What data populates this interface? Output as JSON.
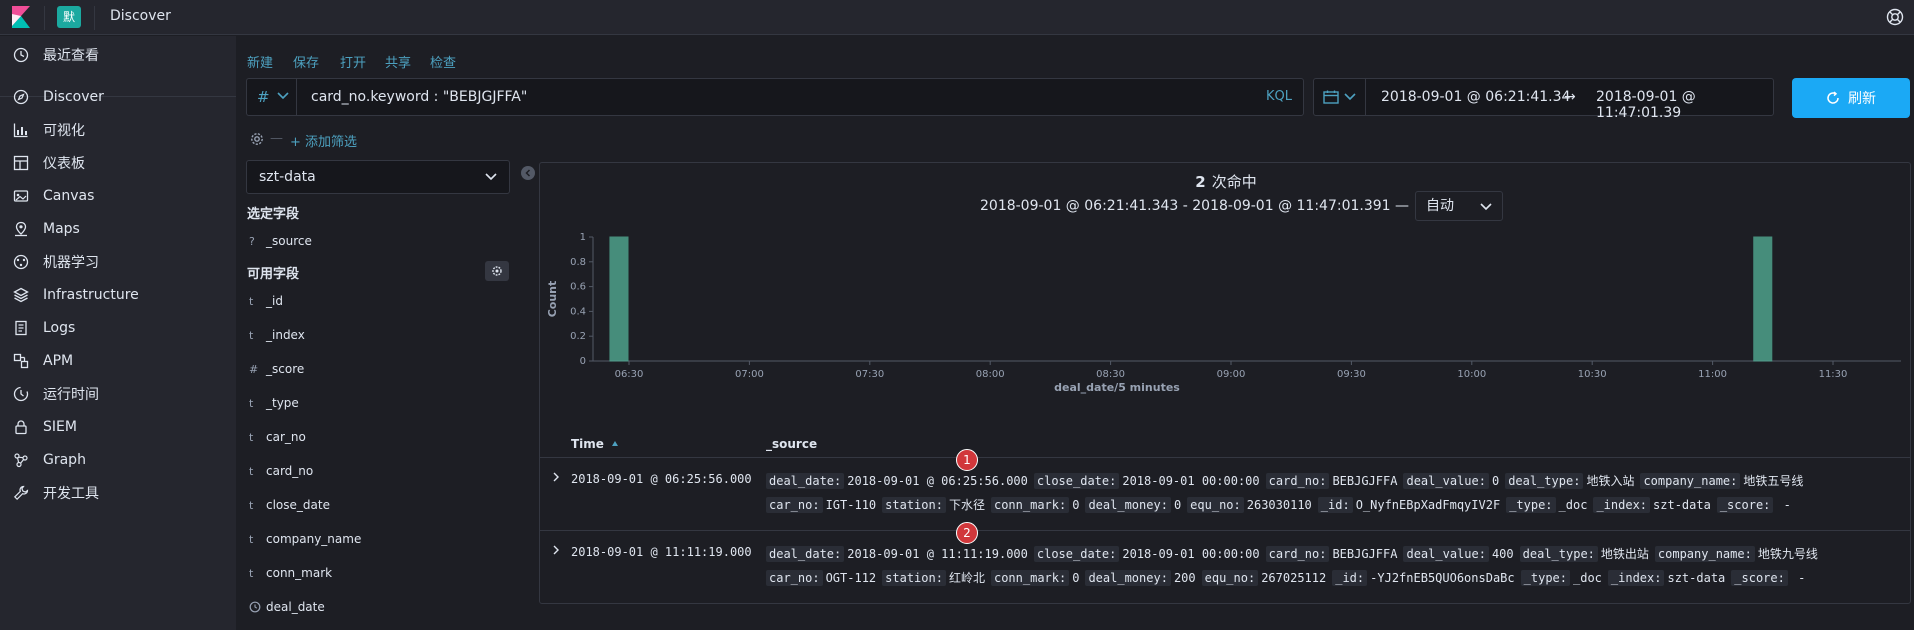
{
  "header": {
    "space_badge": "默",
    "app_title": "Discover"
  },
  "nav": {
    "items": [
      {
        "label": "最近查看",
        "icon": "clock-icon"
      },
      {
        "label": "Discover",
        "icon": "compass-icon"
      },
      {
        "label": "可视化",
        "icon": "visualize-icon"
      },
      {
        "label": "仪表板",
        "icon": "dashboard-icon"
      },
      {
        "label": "Canvas",
        "icon": "canvas-icon"
      },
      {
        "label": "Maps",
        "icon": "maps-icon"
      },
      {
        "label": "机器学习",
        "icon": "ml-icon"
      },
      {
        "label": "Infrastructure",
        "icon": "infrastructure-icon"
      },
      {
        "label": "Logs",
        "icon": "logs-icon"
      },
      {
        "label": "APM",
        "icon": "apm-icon"
      },
      {
        "label": "运行时间",
        "icon": "uptime-icon"
      },
      {
        "label": "SIEM",
        "icon": "siem-icon"
      },
      {
        "label": "Graph",
        "icon": "graph-icon"
      },
      {
        "label": "开发工具",
        "icon": "devtools-icon"
      }
    ]
  },
  "app_links": [
    "新建",
    "保存",
    "打开",
    "共享",
    "检查"
  ],
  "query": {
    "type_symbol": "#",
    "text": "card_no.keyword : \"BEBJGJFFA\"",
    "language": "KQL"
  },
  "date_picker": {
    "start": "2018-09-01 @ 06:21:41.34",
    "arrow": "→",
    "end": "2018-09-01 @ 11:47:01.39"
  },
  "refresh_label": "刷新",
  "filter": {
    "dash": "—",
    "add_label": "+ 添加筛选"
  },
  "sidebar": {
    "index_pattern": "szt-data",
    "selected_title": "选定字段",
    "selected_fields": [
      {
        "type": "?",
        "name": "_source"
      }
    ],
    "available_title": "可用字段",
    "available_fields": [
      {
        "type": "t",
        "name": "_id"
      },
      {
        "type": "t",
        "name": "_index"
      },
      {
        "type": "#",
        "name": "_score"
      },
      {
        "type": "t",
        "name": "_type"
      },
      {
        "type": "t",
        "name": "car_no"
      },
      {
        "type": "t",
        "name": "card_no"
      },
      {
        "type": "t",
        "name": "close_date"
      },
      {
        "type": "t",
        "name": "company_name"
      },
      {
        "type": "t",
        "name": "conn_mark"
      },
      {
        "type": "clock",
        "name": "deal_date"
      }
    ]
  },
  "hits": {
    "count": "2",
    "label": "次命中"
  },
  "range": {
    "text": "2018-09-01 @ 06:21:41.343 - 2018-09-01 @ 11:47:01.391 —",
    "interval": "自动"
  },
  "chart_data": {
    "type": "bar",
    "xlabel": "deal_date/5 minutes",
    "ylabel": "Count",
    "ylim": [
      0,
      1
    ],
    "yticks": [
      "0",
      "0.2",
      "0.4",
      "0.6",
      "0.8",
      "1"
    ],
    "xticks": [
      "06:30",
      "07:00",
      "07:30",
      "08:00",
      "08:30",
      "09:00",
      "09:30",
      "10:00",
      "10:30",
      "11:00",
      "11:30"
    ],
    "bars": [
      {
        "bucket": "06:25",
        "value": 1
      },
      {
        "bucket": "11:10",
        "value": 1
      }
    ],
    "bar_color": "#54b399"
  },
  "table": {
    "time_header": "Time",
    "source_header": "_source",
    "rows": [
      {
        "marker": "1",
        "time": "2018-09-01 @ 06:25:56.000",
        "line1": [
          [
            "deal_date:",
            "2018-09-01 @ 06:25:56.000"
          ],
          [
            "close_date:",
            "2018-09-01 00:00:00"
          ],
          [
            "card_no:",
            "BEBJGJFFA"
          ],
          [
            "deal_value:",
            "0"
          ],
          [
            "deal_type:",
            "地铁入站"
          ],
          [
            "company_name:",
            "地铁五号线"
          ]
        ],
        "line2": [
          [
            "car_no:",
            "IGT-110"
          ],
          [
            "station:",
            "下水径"
          ],
          [
            "conn_mark:",
            "0"
          ],
          [
            "deal_money:",
            "0"
          ],
          [
            "equ_no:",
            "263030110"
          ],
          [
            "_id:",
            "O_NyfnEBpXadFmqyIV2F"
          ],
          [
            "_type:",
            "_doc"
          ],
          [
            "_index:",
            "szt-data"
          ],
          [
            "_score:",
            " -"
          ]
        ]
      },
      {
        "marker": "2",
        "time": "2018-09-01 @ 11:11:19.000",
        "line1": [
          [
            "deal_date:",
            "2018-09-01 @ 11:11:19.000"
          ],
          [
            "close_date:",
            "2018-09-01 00:00:00"
          ],
          [
            "card_no:",
            "BEBJGJFFA"
          ],
          [
            "deal_value:",
            "400"
          ],
          [
            "deal_type:",
            "地铁出站"
          ],
          [
            "company_name:",
            "地铁九号线"
          ]
        ],
        "line2": [
          [
            "car_no:",
            "OGT-112"
          ],
          [
            "station:",
            "红岭北"
          ],
          [
            "conn_mark:",
            "0"
          ],
          [
            "deal_money:",
            "200"
          ],
          [
            "equ_no:",
            "267025112"
          ],
          [
            "_id:",
            "-YJ2fnEB5QUO6onsDaBc"
          ],
          [
            "_type:",
            "_doc"
          ],
          [
            "_index:",
            "szt-data"
          ],
          [
            "_score:",
            " -"
          ]
        ]
      }
    ]
  },
  "colors": {
    "accent": "#1ba9f5",
    "link": "#4da1c0",
    "bar": "#54b399",
    "marker": "#d1373b"
  }
}
